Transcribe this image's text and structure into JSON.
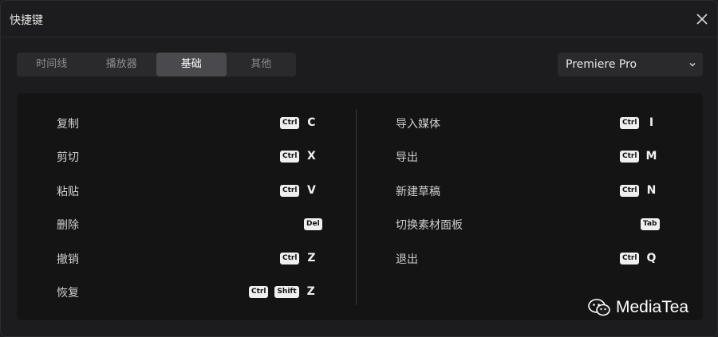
{
  "window": {
    "title": "快捷键"
  },
  "tabs": [
    {
      "label": "时间线"
    },
    {
      "label": "播放器"
    },
    {
      "label": "基础",
      "active": true
    },
    {
      "label": "其他"
    }
  ],
  "preset": {
    "value": "Premiere Pro"
  },
  "shortcuts_left": [
    {
      "label": "复制",
      "keys": [
        "Ctrl"
      ],
      "letter": "C"
    },
    {
      "label": "剪切",
      "keys": [
        "Ctrl"
      ],
      "letter": "X"
    },
    {
      "label": "粘贴",
      "keys": [
        "Ctrl"
      ],
      "letter": "V"
    },
    {
      "label": "删除",
      "keys": [
        "Del"
      ],
      "letter": ""
    },
    {
      "label": "撤销",
      "keys": [
        "Ctrl"
      ],
      "letter": "Z"
    },
    {
      "label": "恢复",
      "keys": [
        "Ctrl",
        "Shift"
      ],
      "letter": "Z"
    }
  ],
  "shortcuts_right": [
    {
      "label": "导入媒体",
      "keys": [
        "Ctrl"
      ],
      "letter": "I"
    },
    {
      "label": "导出",
      "keys": [
        "Ctrl"
      ],
      "letter": "M"
    },
    {
      "label": "新建草稿",
      "keys": [
        "Ctrl"
      ],
      "letter": "N"
    },
    {
      "label": "切换素材面板",
      "keys": [
        "Tab"
      ],
      "letter": ""
    },
    {
      "label": "退出",
      "keys": [
        "Ctrl"
      ],
      "letter": "Q"
    }
  ],
  "watermark": {
    "text": "MediaTea"
  },
  "colors": {
    "background": "#1c1c1e",
    "panel": "#141415",
    "tab_active": "#4a4a4e",
    "key_cap": "#efefef"
  }
}
